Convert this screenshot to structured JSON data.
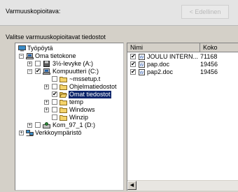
{
  "header": {
    "backup_label": "Varmuuskopioitava:",
    "back_button": "< Edellinen"
  },
  "select_label": "Valitse varmuuskopioitavat tiedostot",
  "tree": [
    {
      "label": "Työpöytä",
      "icon": "desktop-icon"
    },
    {
      "label": "Oma tietokone",
      "icon": "computer-icon",
      "expander": "−"
    },
    {
      "label": "3½-levyke (A:)",
      "icon": "floppy-icon",
      "expander": "+",
      "checked": false
    },
    {
      "label": "Kompuutteri (C:)",
      "icon": "hard-drive-icon",
      "expander": "−",
      "checked": true
    },
    {
      "label": "~mssetup.t",
      "icon": "folder-icon",
      "checked": false
    },
    {
      "label": "Ohjelmatiedostot",
      "icon": "folder-icon",
      "expander": "+",
      "checked": false
    },
    {
      "label": "Omat tiedostot",
      "icon": "folder-icon",
      "checked": true,
      "selected": true
    },
    {
      "label": "temp",
      "icon": "folder-icon",
      "expander": "+",
      "checked": false
    },
    {
      "label": "Windows",
      "icon": "folder-icon",
      "expander": "+",
      "checked": false
    },
    {
      "label": "Winzip",
      "icon": "folder-icon",
      "checked": false
    },
    {
      "label": "Kom_97_1 (D:)",
      "icon": "drive-icon",
      "expander": "+",
      "checked": false
    },
    {
      "label": "Verkkoympäristö",
      "icon": "network-icon",
      "expander": "+"
    }
  ],
  "list": {
    "columns": [
      "Nimi",
      "Koko"
    ],
    "rows": [
      {
        "name": "JOULU INTERN...",
        "size": "71168",
        "checked": true
      },
      {
        "name": "pap.doc",
        "size": "19456",
        "checked": true
      },
      {
        "name": "pap2.doc",
        "size": "19456",
        "checked": true
      }
    ]
  },
  "colors": {
    "selection": "#0a246a",
    "folder": "#f4d36b",
    "window": "#d4d0c8"
  }
}
